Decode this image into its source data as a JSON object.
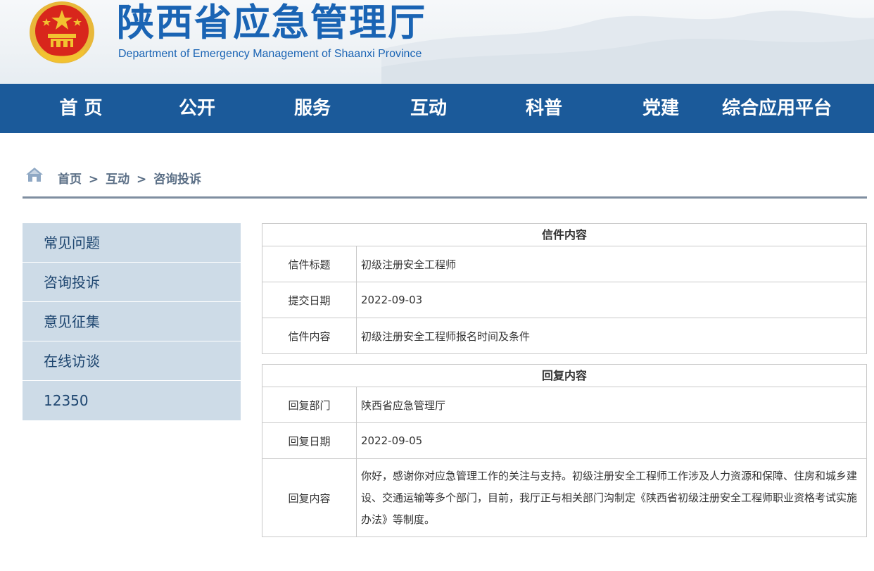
{
  "header": {
    "title": "陕西省应急管理厅",
    "subtitle": "Department of Emergency Management of Shaanxi Province"
  },
  "nav": {
    "items": [
      "首 页",
      "公开",
      "服务",
      "互动",
      "科普",
      "党建",
      "综合应用平台"
    ]
  },
  "breadcrumb": {
    "items": [
      "首页",
      "互动",
      "咨询投诉"
    ],
    "separator": ">"
  },
  "sidebar": {
    "items": [
      "常见问题",
      "咨询投诉",
      "意见征集",
      "在线访谈",
      "12350"
    ]
  },
  "letter": {
    "heading": "信件内容",
    "rows": [
      {
        "label": "信件标题",
        "value": "初级注册安全工程师"
      },
      {
        "label": "提交日期",
        "value": "2022-09-03"
      },
      {
        "label": "信件内容",
        "value": "初级注册安全工程师报名时间及条件"
      }
    ]
  },
  "reply": {
    "heading": "回复内容",
    "rows": [
      {
        "label": "回复部门",
        "value": "陕西省应急管理厅"
      },
      {
        "label": "回复日期",
        "value": "2022-09-05"
      },
      {
        "label": "回复内容",
        "value": "你好，感谢你对应急管理工作的关注与支持。初级注册安全工程师工作涉及人力资源和保障、住房和城乡建设、交通运输等多个部门，目前，我厅正与相关部门沟制定《陕西省初级注册安全工程师职业资格考试实施办法》等制度。"
      }
    ]
  },
  "colors": {
    "brand_blue": "#1a64b4",
    "nav_bg": "#1b5a9a",
    "sidebar_bg": "#cddbe7",
    "emblem_red": "#d8261c",
    "emblem_gold": "#f2c230"
  }
}
